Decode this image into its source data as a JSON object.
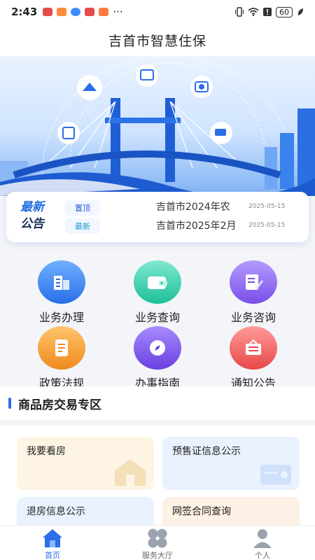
{
  "status_bar": {
    "time": "2:43",
    "more": "···",
    "battery": "60"
  },
  "header": {
    "title": "吉首市智慧住保"
  },
  "notice": {
    "logo_line1": "最新",
    "logo_line2": "公告",
    "items": [
      {
        "tag": "置顶",
        "text": "吉首市2024年农",
        "date": "2025-05-15"
      },
      {
        "tag": "最新",
        "text": "吉首市2025年2月",
        "date": "2025-05-15"
      }
    ]
  },
  "services": [
    {
      "label": "业务办理",
      "icon": "building-icon"
    },
    {
      "label": "业务查询",
      "icon": "wallet-icon"
    },
    {
      "label": "业务咨询",
      "icon": "edit-document-icon"
    },
    {
      "label": "政策法规",
      "icon": "book-icon"
    },
    {
      "label": "办事指南",
      "icon": "compass-icon"
    },
    {
      "label": "通知公告",
      "icon": "announcement-icon"
    }
  ],
  "section": {
    "title": "商品房交易专区"
  },
  "cards": [
    {
      "label": "我要看房"
    },
    {
      "label": "预售证信息公示"
    },
    {
      "label": "退房信息公示"
    },
    {
      "label": "网签合同查询"
    }
  ],
  "tabbar": {
    "items": [
      {
        "label": "首页"
      },
      {
        "label": "服务大厅"
      },
      {
        "label": "个人"
      }
    ]
  },
  "colors": {
    "primary": "#2a6ee8",
    "background": "#f3f5f9"
  }
}
